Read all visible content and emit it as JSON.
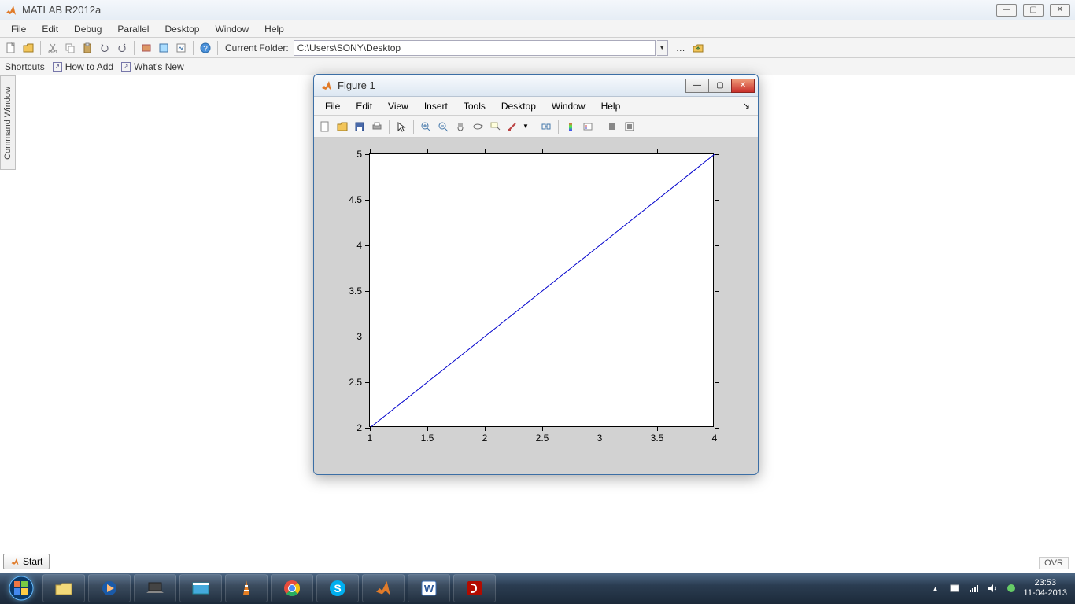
{
  "app": {
    "title": "MATLAB  R2012a"
  },
  "main_menu": [
    "File",
    "Edit",
    "Debug",
    "Parallel",
    "Desktop",
    "Window",
    "Help"
  ],
  "toolbar": {
    "current_folder_label": "Current Folder:",
    "current_folder_value": "C:\\Users\\SONY\\Desktop"
  },
  "shortcuts": {
    "label": "Shortcuts",
    "how_to_add": "How to Add",
    "whats_new": "What's New"
  },
  "command_window_tab": "Command Window",
  "start_label": "Start",
  "ovr_label": "OVR",
  "figure": {
    "title": "Figure 1",
    "menu": [
      "File",
      "Edit",
      "View",
      "Insert",
      "Tools",
      "Desktop",
      "Window",
      "Help"
    ]
  },
  "chart_data": {
    "type": "line",
    "x": [
      1,
      4
    ],
    "y": [
      2,
      5
    ],
    "xlim": [
      1,
      4
    ],
    "ylim": [
      2,
      5
    ],
    "xticks": [
      1,
      1.5,
      2,
      2.5,
      3,
      3.5,
      4
    ],
    "yticks": [
      2,
      2.5,
      3,
      3.5,
      4,
      4.5,
      5
    ],
    "line_color": "#0000cc"
  },
  "taskbar": {
    "time": "23:53",
    "date": "11-04-2013"
  }
}
